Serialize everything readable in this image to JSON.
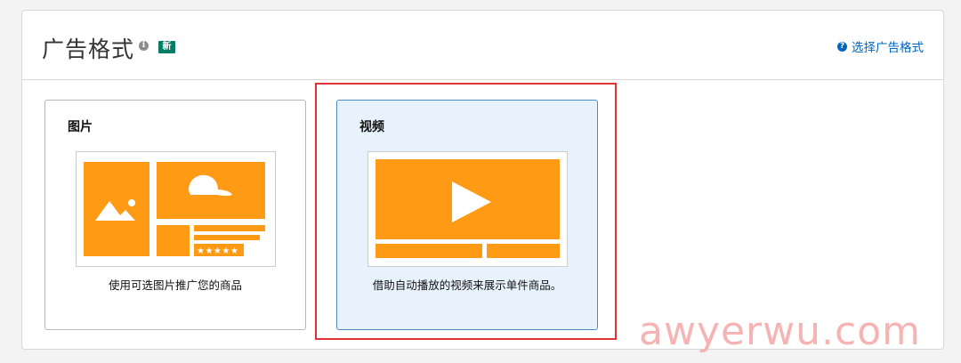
{
  "header": {
    "title": "广告格式",
    "info_glyph": "i",
    "new_badge": "新",
    "help_glyph": "?",
    "help_link": "选择广告格式"
  },
  "cards": [
    {
      "title": "图片",
      "description": "使用可选图片推广您的商品",
      "selected": false,
      "stars": "★★★★★"
    },
    {
      "title": "视频",
      "description": "借助自动播放的视频来展示单件商品。",
      "selected": true
    }
  ],
  "colors": {
    "accent": "#ff9a14",
    "link": "#0066c0",
    "badge": "#067d62",
    "highlight": "#e03434",
    "selected_bg": "#e8f2fd"
  },
  "watermark": "awyerwu.com"
}
